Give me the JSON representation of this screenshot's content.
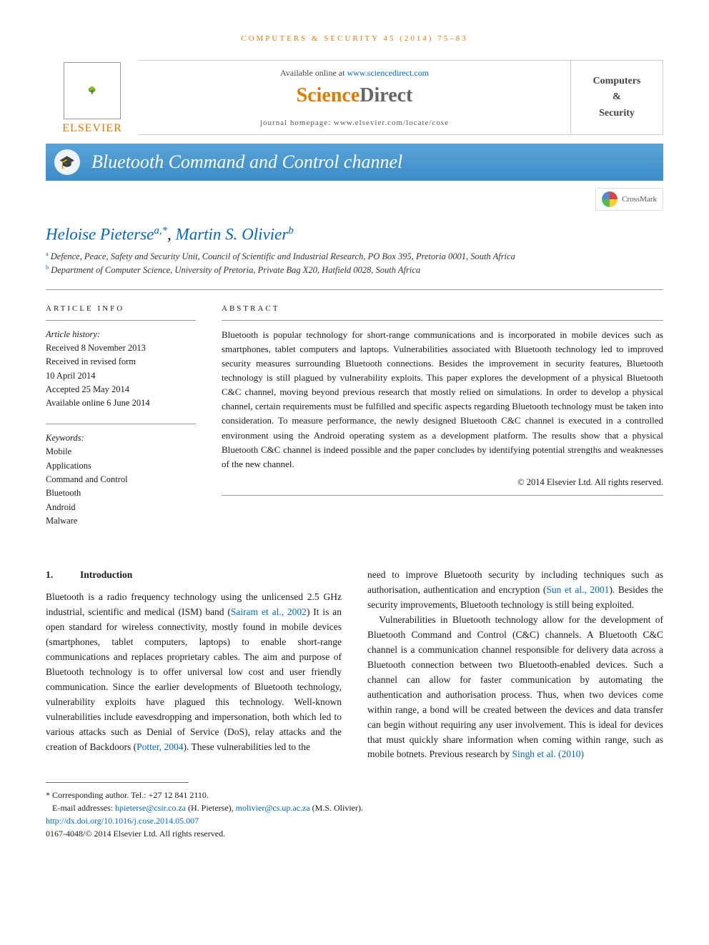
{
  "journal_ref": "COMPUTERS & SECURITY 45 (2014) 75–83",
  "availability": {
    "prefix": "Available online at ",
    "link": "www.sciencedirect.com"
  },
  "sd_logo": {
    "a": "Science",
    "b": "Direct"
  },
  "homepage": {
    "label": "journal homepage: ",
    "url": "www.elsevier.com/locate/cose"
  },
  "publisher": "ELSEVIER",
  "cover": {
    "l1": "Computers",
    "l2": "&",
    "l3": "Security"
  },
  "title": "Bluetooth Command and Control channel",
  "crossmark": "CrossMark",
  "authors": {
    "a1_name": "Heloise Pieterse",
    "a1_affs": "a,",
    "a1_corr": "*",
    "sep": ", ",
    "a2_name": "Martin S. Olivier",
    "a2_affs": "b"
  },
  "affiliations": {
    "a": "Defence, Peace, Safety and Security Unit, Council of Scientific and Industrial Research, PO Box 395, Pretoria 0001, South Africa",
    "b": "Department of Computer Science, University of Pretoria, Private Bag X20, Hatfield 0028, South Africa"
  },
  "info_heading": "ARTICLE INFO",
  "history": {
    "label": "Article history:",
    "received": "Received 8 November 2013",
    "revised1": "Received in revised form",
    "revised2": "10 April 2014",
    "accepted": "Accepted 25 May 2014",
    "online": "Available online 6 June 2014"
  },
  "kw_label": "Keywords:",
  "keywords": [
    "Mobile",
    "Applications",
    "Command and Control",
    "Bluetooth",
    "Android",
    "Malware"
  ],
  "abstract_heading": "ABSTRACT",
  "abstract": "Bluetooth is popular technology for short-range communications and is incorporated in mobile devices such as smartphones, tablet computers and laptops. Vulnerabilities associated with Bluetooth technology led to improved security measures surrounding Bluetooth connections. Besides the improvement in security features, Bluetooth technology is still plagued by vulnerability exploits. This paper explores the development of a physical Bluetooth C&C channel, moving beyond previous research that mostly relied on simulations. In order to develop a physical channel, certain requirements must be fulfilled and specific aspects regarding Bluetooth technology must be taken into consideration. To measure performance, the newly designed Bluetooth C&C channel is executed in a controlled environment using the Android operating system as a development platform. The results show that a physical Bluetooth C&C channel is indeed possible and the paper concludes by identifying potential strengths and weaknesses of the new channel.",
  "copyright": "© 2014 Elsevier Ltd. All rights reserved.",
  "section1": {
    "num": "1.",
    "title": "Introduction"
  },
  "col1_p1a": "Bluetooth is a radio frequency technology using the unlicensed 2.5 GHz industrial, scientific and medical (ISM) band (",
  "col1_ref1": "Sairam et al., 2002",
  "col1_p1b": ") It is an open standard for wireless connectivity, mostly found in mobile devices (smartphones, tablet computers, laptops) to enable short-range communications and replaces proprietary cables. The aim and purpose of Bluetooth technology is to offer universal low cost and user friendly communication. Since the earlier developments of Bluetooth technology, vulnerability exploits have plagued this technology. Well-known vulnerabilities include eavesdropping and impersonation, both which led to various attacks such as Denial of Service (DoS), relay attacks and the creation of Backdoors (",
  "col1_ref2": "Potter, 2004",
  "col1_p1c": "). These vulnerabilities led to the",
  "col2_p1a": "need to improve Bluetooth security by including techniques such as authorisation, authentication and encryption (",
  "col2_ref1": "Sun et al., 2001",
  "col2_p1b": "). Besides the security improvements, Bluetooth technology is still being exploited.",
  "col2_p2a": "Vulnerabilities in Bluetooth technology allow for the development of Bluetooth Command and Control (C&C) channels. A Bluetooth C&C channel is a communication channel responsible for delivery data across a Bluetooth connection between two Bluetooth-enabled devices. Such a channel can allow for faster communication by automating the authentication and authorisation process. Thus, when two devices come within range, a bond will be created between the devices and data transfer can begin without requiring any user involvement. This is ideal for devices that must quickly share information when coming within range, such as mobile botnets. Previous research by ",
  "col2_ref2": "Singh et al. (2010)",
  "footnotes": {
    "corr": "* Corresponding author. Tel.: +27 12 841 2110.",
    "email_label": "E-mail addresses: ",
    "e1": "hpieterse@csir.co.za",
    "e1_tail": " (H. Pieterse), ",
    "e2": "molivier@cs.up.ac.za",
    "e2_tail": " (M.S. Olivier).",
    "doi": "http://dx.doi.org/10.1016/j.cose.2014.05.007",
    "issn": "0167-4048/© 2014 Elsevier Ltd. All rights reserved."
  }
}
